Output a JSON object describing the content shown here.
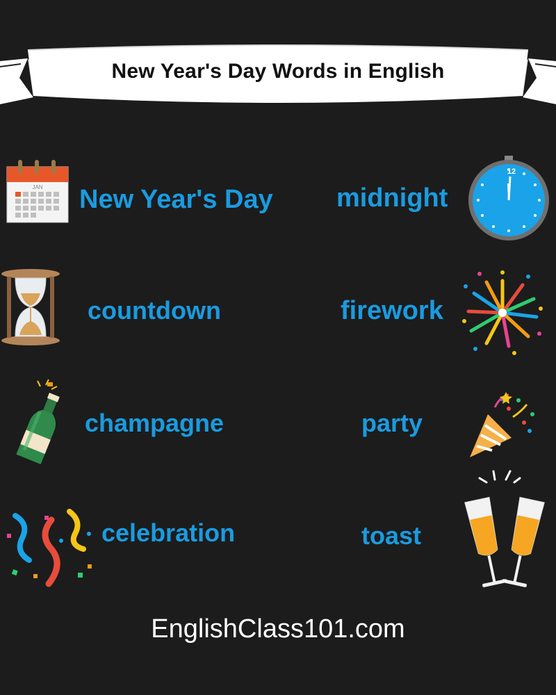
{
  "title": "New Year's Day Words in English",
  "words": {
    "new_years_day": "New Year's Day",
    "midnight": "midnight",
    "countdown": "countdown",
    "firework": "firework",
    "champagne": "champagne",
    "party": "party",
    "celebration": "celebration",
    "toast": "toast"
  },
  "calendar_month": "JAN",
  "clock_number": "12",
  "footer": "EnglishClass101.com",
  "colors": {
    "background": "#1c1c1c",
    "word": "#1a9be0",
    "banner": "#ffffff"
  }
}
